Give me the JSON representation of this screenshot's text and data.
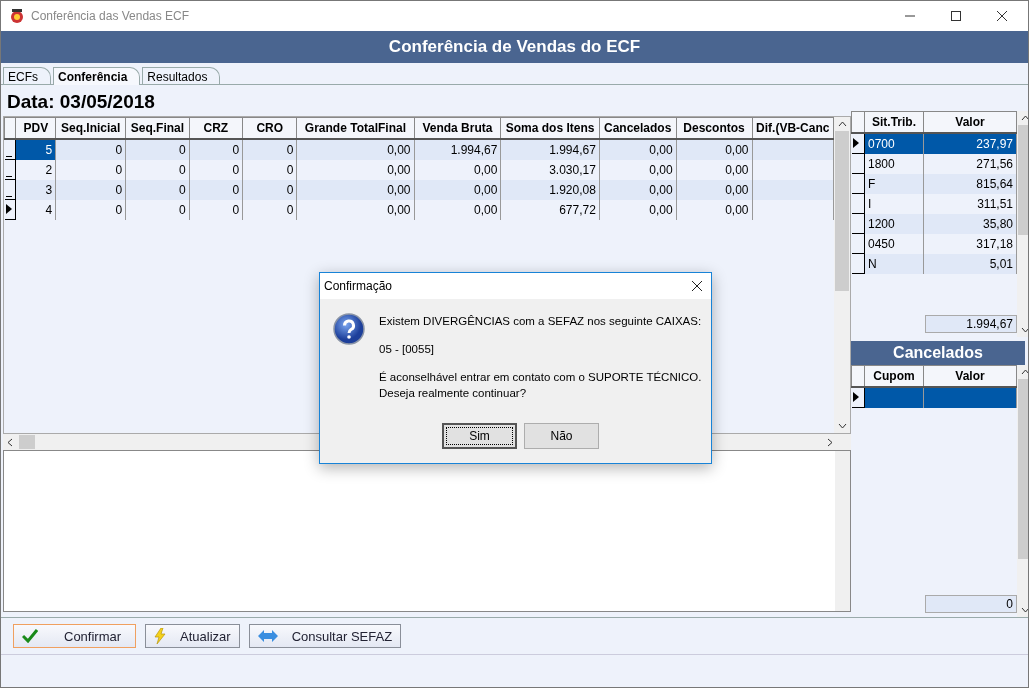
{
  "window": {
    "title": "Conferência das Vendas ECF"
  },
  "header": {
    "title": "Conferência de Vendas do ECF"
  },
  "tabs": [
    {
      "label": "ECFs",
      "selected": false
    },
    {
      "label": "Conferência",
      "selected": true
    },
    {
      "label": "Resultados",
      "selected": false
    }
  ],
  "date_label": "Data: 03/05/2018",
  "table": {
    "columns": [
      "PDV",
      "Seq.Inicial",
      "Seq.Final",
      "CRZ",
      "CRO",
      "Grande TotalFinal",
      "Venda Bruta",
      "Soma dos Itens",
      "Cancelados",
      "Descontos",
      "Dif.(VB-Canc"
    ],
    "rows": [
      {
        "cells": [
          "5",
          "0",
          "0",
          "0",
          "0",
          "0,00",
          "1.994,67",
          "1.994,67",
          "0,00",
          "0,00",
          ""
        ],
        "selected": true,
        "current": false
      },
      {
        "cells": [
          "2",
          "0",
          "0",
          "0",
          "0",
          "0,00",
          "0,00",
          "3.030,17",
          "0,00",
          "0,00",
          ""
        ],
        "selected": false,
        "current": false
      },
      {
        "cells": [
          "3",
          "0",
          "0",
          "0",
          "0",
          "0,00",
          "0,00",
          "1.920,08",
          "0,00",
          "0,00",
          ""
        ],
        "selected": false,
        "current": false
      },
      {
        "cells": [
          "4",
          "0",
          "0",
          "0",
          "0",
          "0,00",
          "0,00",
          "677,72",
          "0,00",
          "0,00",
          ""
        ],
        "selected": false,
        "current": true
      }
    ]
  },
  "tax_table": {
    "columns": [
      "Sit.Trib.",
      "Valor"
    ],
    "rows": [
      {
        "cells": [
          "0700",
          "237,97"
        ],
        "selected": true,
        "current": true
      },
      {
        "cells": [
          "1800",
          "271,56"
        ],
        "selected": false,
        "current": false
      },
      {
        "cells": [
          "F",
          "815,64"
        ],
        "selected": false,
        "current": false
      },
      {
        "cells": [
          "I",
          "311,51"
        ],
        "selected": false,
        "current": false
      },
      {
        "cells": [
          "1200",
          "35,80"
        ],
        "selected": false,
        "current": false
      },
      {
        "cells": [
          "0450",
          "317,18"
        ],
        "selected": false,
        "current": false
      },
      {
        "cells": [
          "N",
          "5,01"
        ],
        "selected": false,
        "current": false
      }
    ],
    "total": "1.994,67"
  },
  "cancelados": {
    "title": "Cancelados",
    "columns": [
      "Cupom",
      "Valor"
    ],
    "rows": [
      {
        "cells": [
          "",
          ""
        ],
        "selected": true,
        "current": true
      }
    ],
    "total": "0"
  },
  "buttons": [
    {
      "label": "Confirmar",
      "kind": "confirm",
      "focused": true
    },
    {
      "label": "Atualizar",
      "kind": "refresh",
      "focused": false
    },
    {
      "label": "Consultar SEFAZ",
      "kind": "exchange",
      "focused": false
    }
  ],
  "dialog": {
    "title": "Confirmação",
    "lines": [
      "Existem DIVERGÊNCIAS com a SEFAZ nos seguinte CAIXAS:",
      "05 - [0055]",
      "É aconselhável entrar em contato com o SUPORTE TÉCNICO.\nDeseja realmente continuar?"
    ],
    "buttons": [
      {
        "label": "Sim",
        "focused": true
      },
      {
        "label": "Não",
        "focused": false
      }
    ]
  }
}
